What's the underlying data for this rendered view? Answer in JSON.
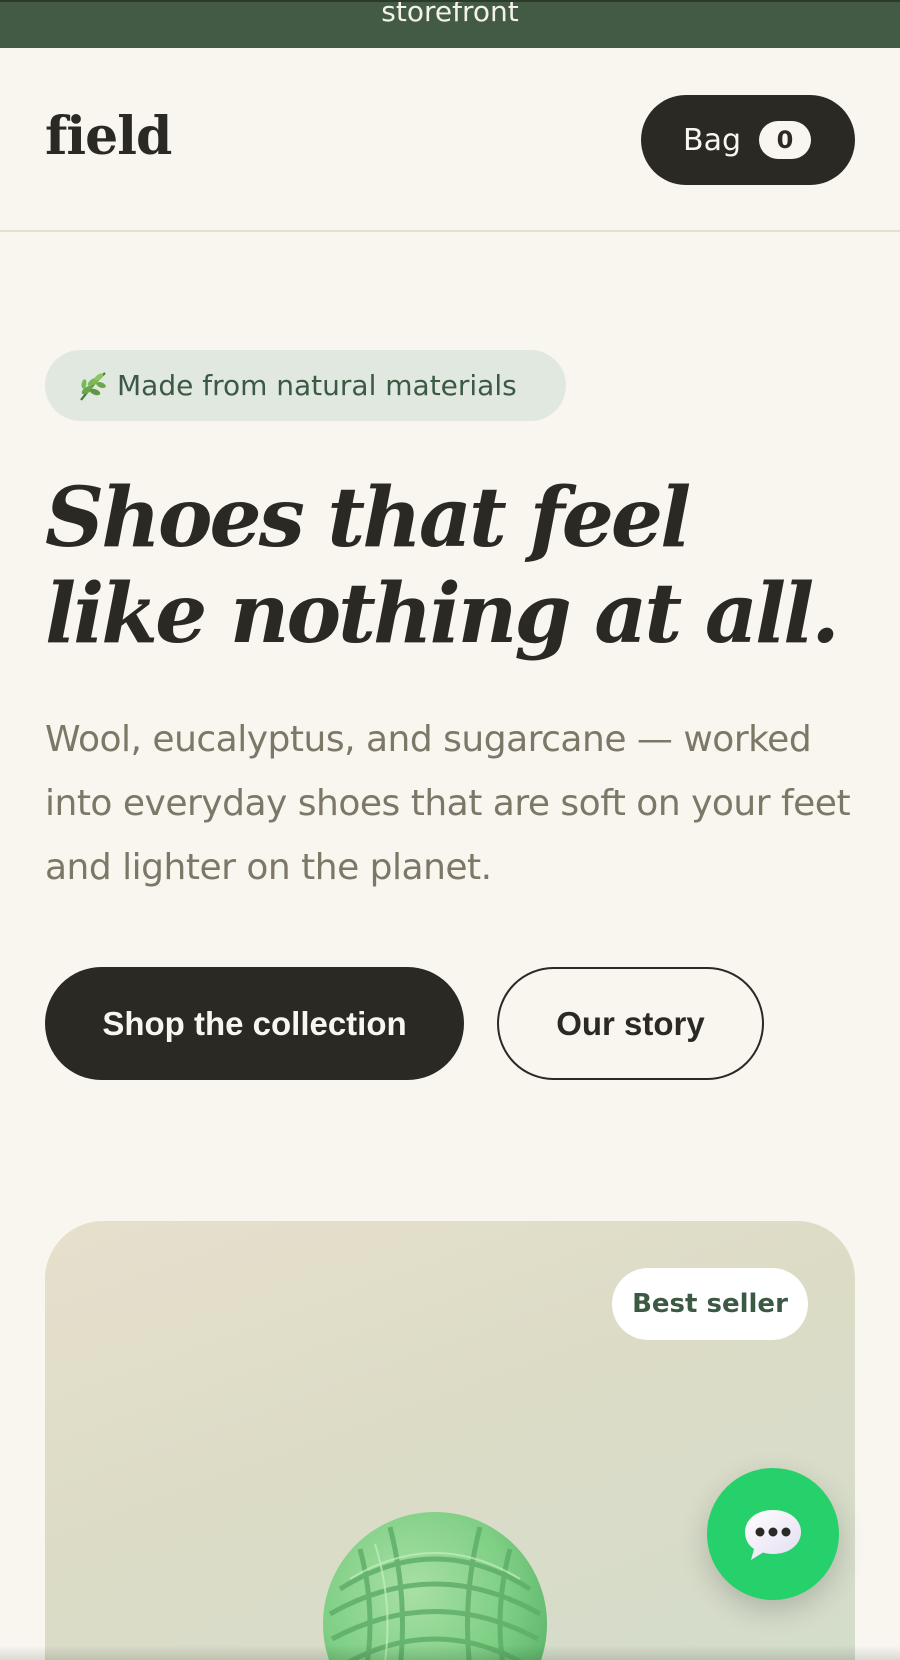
{
  "topbar": {
    "text": "storefront"
  },
  "header": {
    "logo": "field",
    "bag": {
      "label": "Bag",
      "count": "0"
    }
  },
  "hero": {
    "badge": {
      "icon": "herb-icon",
      "text": "Made from natural materials"
    },
    "headline": [
      "Shoes that feel",
      "like nothing at all."
    ],
    "subcopy": "Wool, eucalyptus, and sugarcane — worked into everyday shoes that are soft on your feet and lighter on the planet.",
    "primary_cta": "Shop the collection",
    "secondary_cta": "Our story"
  },
  "product_card": {
    "badge": "Best seller",
    "image_icon": "yarn-ball-icon"
  },
  "chat": {
    "icon": "chat-bubble-icon"
  },
  "colors": {
    "background": "#f9f6f0",
    "topbar": "#435a45",
    "ink": "#2b2924",
    "badge_bg": "#e1e8df",
    "accent_green": "#3c5a43",
    "chat_green": "#26d06b"
  }
}
